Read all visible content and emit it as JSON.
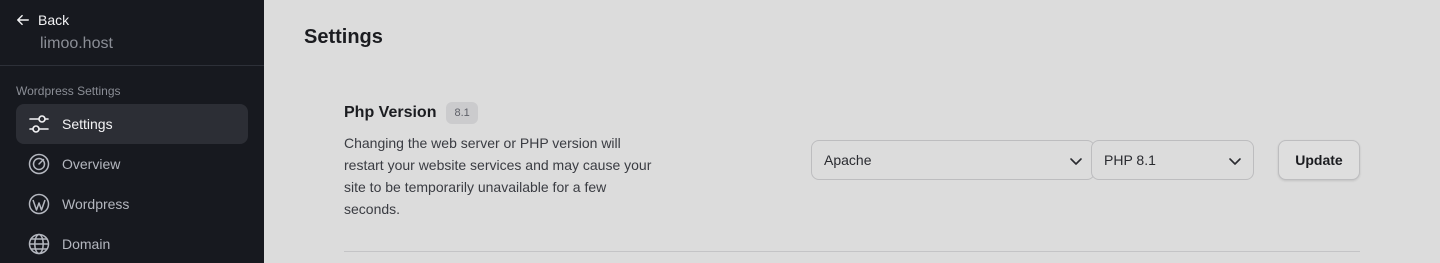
{
  "sidebar": {
    "back_label": "Back",
    "site_name": "limoo.host",
    "section_title": "Wordpress Settings",
    "items": [
      {
        "label": "Settings",
        "icon": "sliders-icon",
        "active": true
      },
      {
        "label": "Overview",
        "icon": "gauge-icon",
        "active": false
      },
      {
        "label": "Wordpress",
        "icon": "wordpress-icon",
        "active": false
      },
      {
        "label": "Domain",
        "icon": "globe-icon",
        "active": false
      }
    ]
  },
  "main": {
    "title": "Settings",
    "php_section": {
      "title": "Php Version",
      "badge": "8.1",
      "description": "Changing the web server or PHP version will restart your website services and may cause your site to be temporarily unavailable for a few seconds.",
      "web_server_select": "Apache",
      "php_select": "PHP 8.1",
      "update_label": "Update"
    }
  },
  "colors": {
    "sidebar_bg": "#17191f",
    "active_item_bg": "#2c2e35",
    "main_bg": "#dcdcdc"
  }
}
